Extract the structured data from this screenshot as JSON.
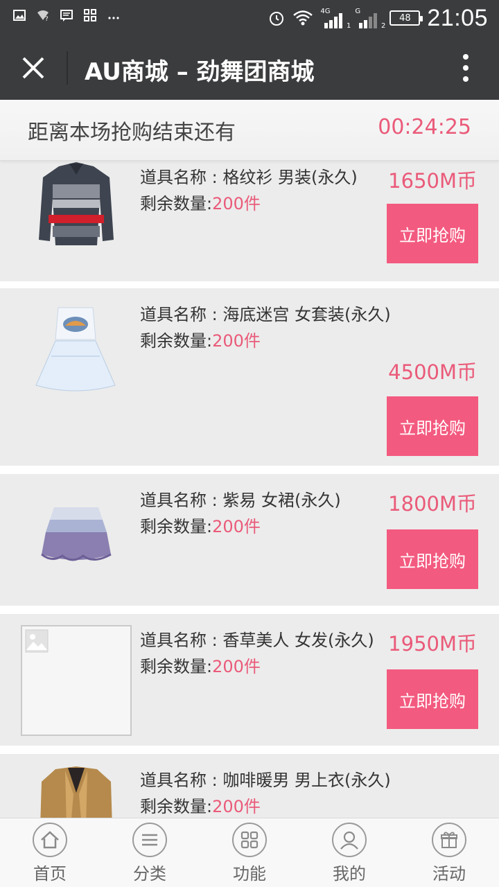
{
  "status_bar": {
    "network_label": "4G",
    "sim1_label": "1",
    "sim2_label": "2",
    "sim_g_label": "G",
    "battery": "48",
    "time": "21:05"
  },
  "app_bar": {
    "title": "AU商城 – 劲舞团商城",
    "close_icon": "close-icon",
    "more_icon": "more-vertical-icon"
  },
  "countdown": {
    "label": "距离本场抢购结束还有",
    "time_left": "00:24:25"
  },
  "products": [
    {
      "name": "道具名称 : 格纹衫 男装(永久)",
      "stock_label": "剩余数量:",
      "stock_value": "200件",
      "price": "1650M币",
      "buy_label": "立即抢购"
    },
    {
      "name": "道具名称 : 海底迷宫 女套装(永久)",
      "stock_label": "剩余数量:",
      "stock_value": "200件",
      "price": "4500M币",
      "buy_label": "立即抢购"
    },
    {
      "name": "道具名称 : 紫易 女裙(永久)",
      "stock_label": "剩余数量:",
      "stock_value": "200件",
      "price": "1800M币",
      "buy_label": "立即抢购"
    },
    {
      "name": "道具名称 : 香草美人 女发(永久)",
      "stock_label": "剩余数量:",
      "stock_value": "200件",
      "price": "1950M币",
      "buy_label": "立即抢购"
    },
    {
      "name": "道具名称 : 咖啡暖男 男上衣(永久)",
      "stock_label": "剩余数量:",
      "stock_value": "200件",
      "price": "",
      "buy_label": ""
    }
  ],
  "bottom_nav": [
    {
      "label": "首页",
      "icon": "home-icon"
    },
    {
      "label": "分类",
      "icon": "menu-icon"
    },
    {
      "label": "功能",
      "icon": "grid-icon"
    },
    {
      "label": "我的",
      "icon": "user-icon"
    },
    {
      "label": "活动",
      "icon": "gift-icon"
    }
  ],
  "colors": {
    "accent": "#f35a7f",
    "price": "#ea5a79",
    "header_bg": "#3b3c3e",
    "card_bg": "#ececec"
  }
}
